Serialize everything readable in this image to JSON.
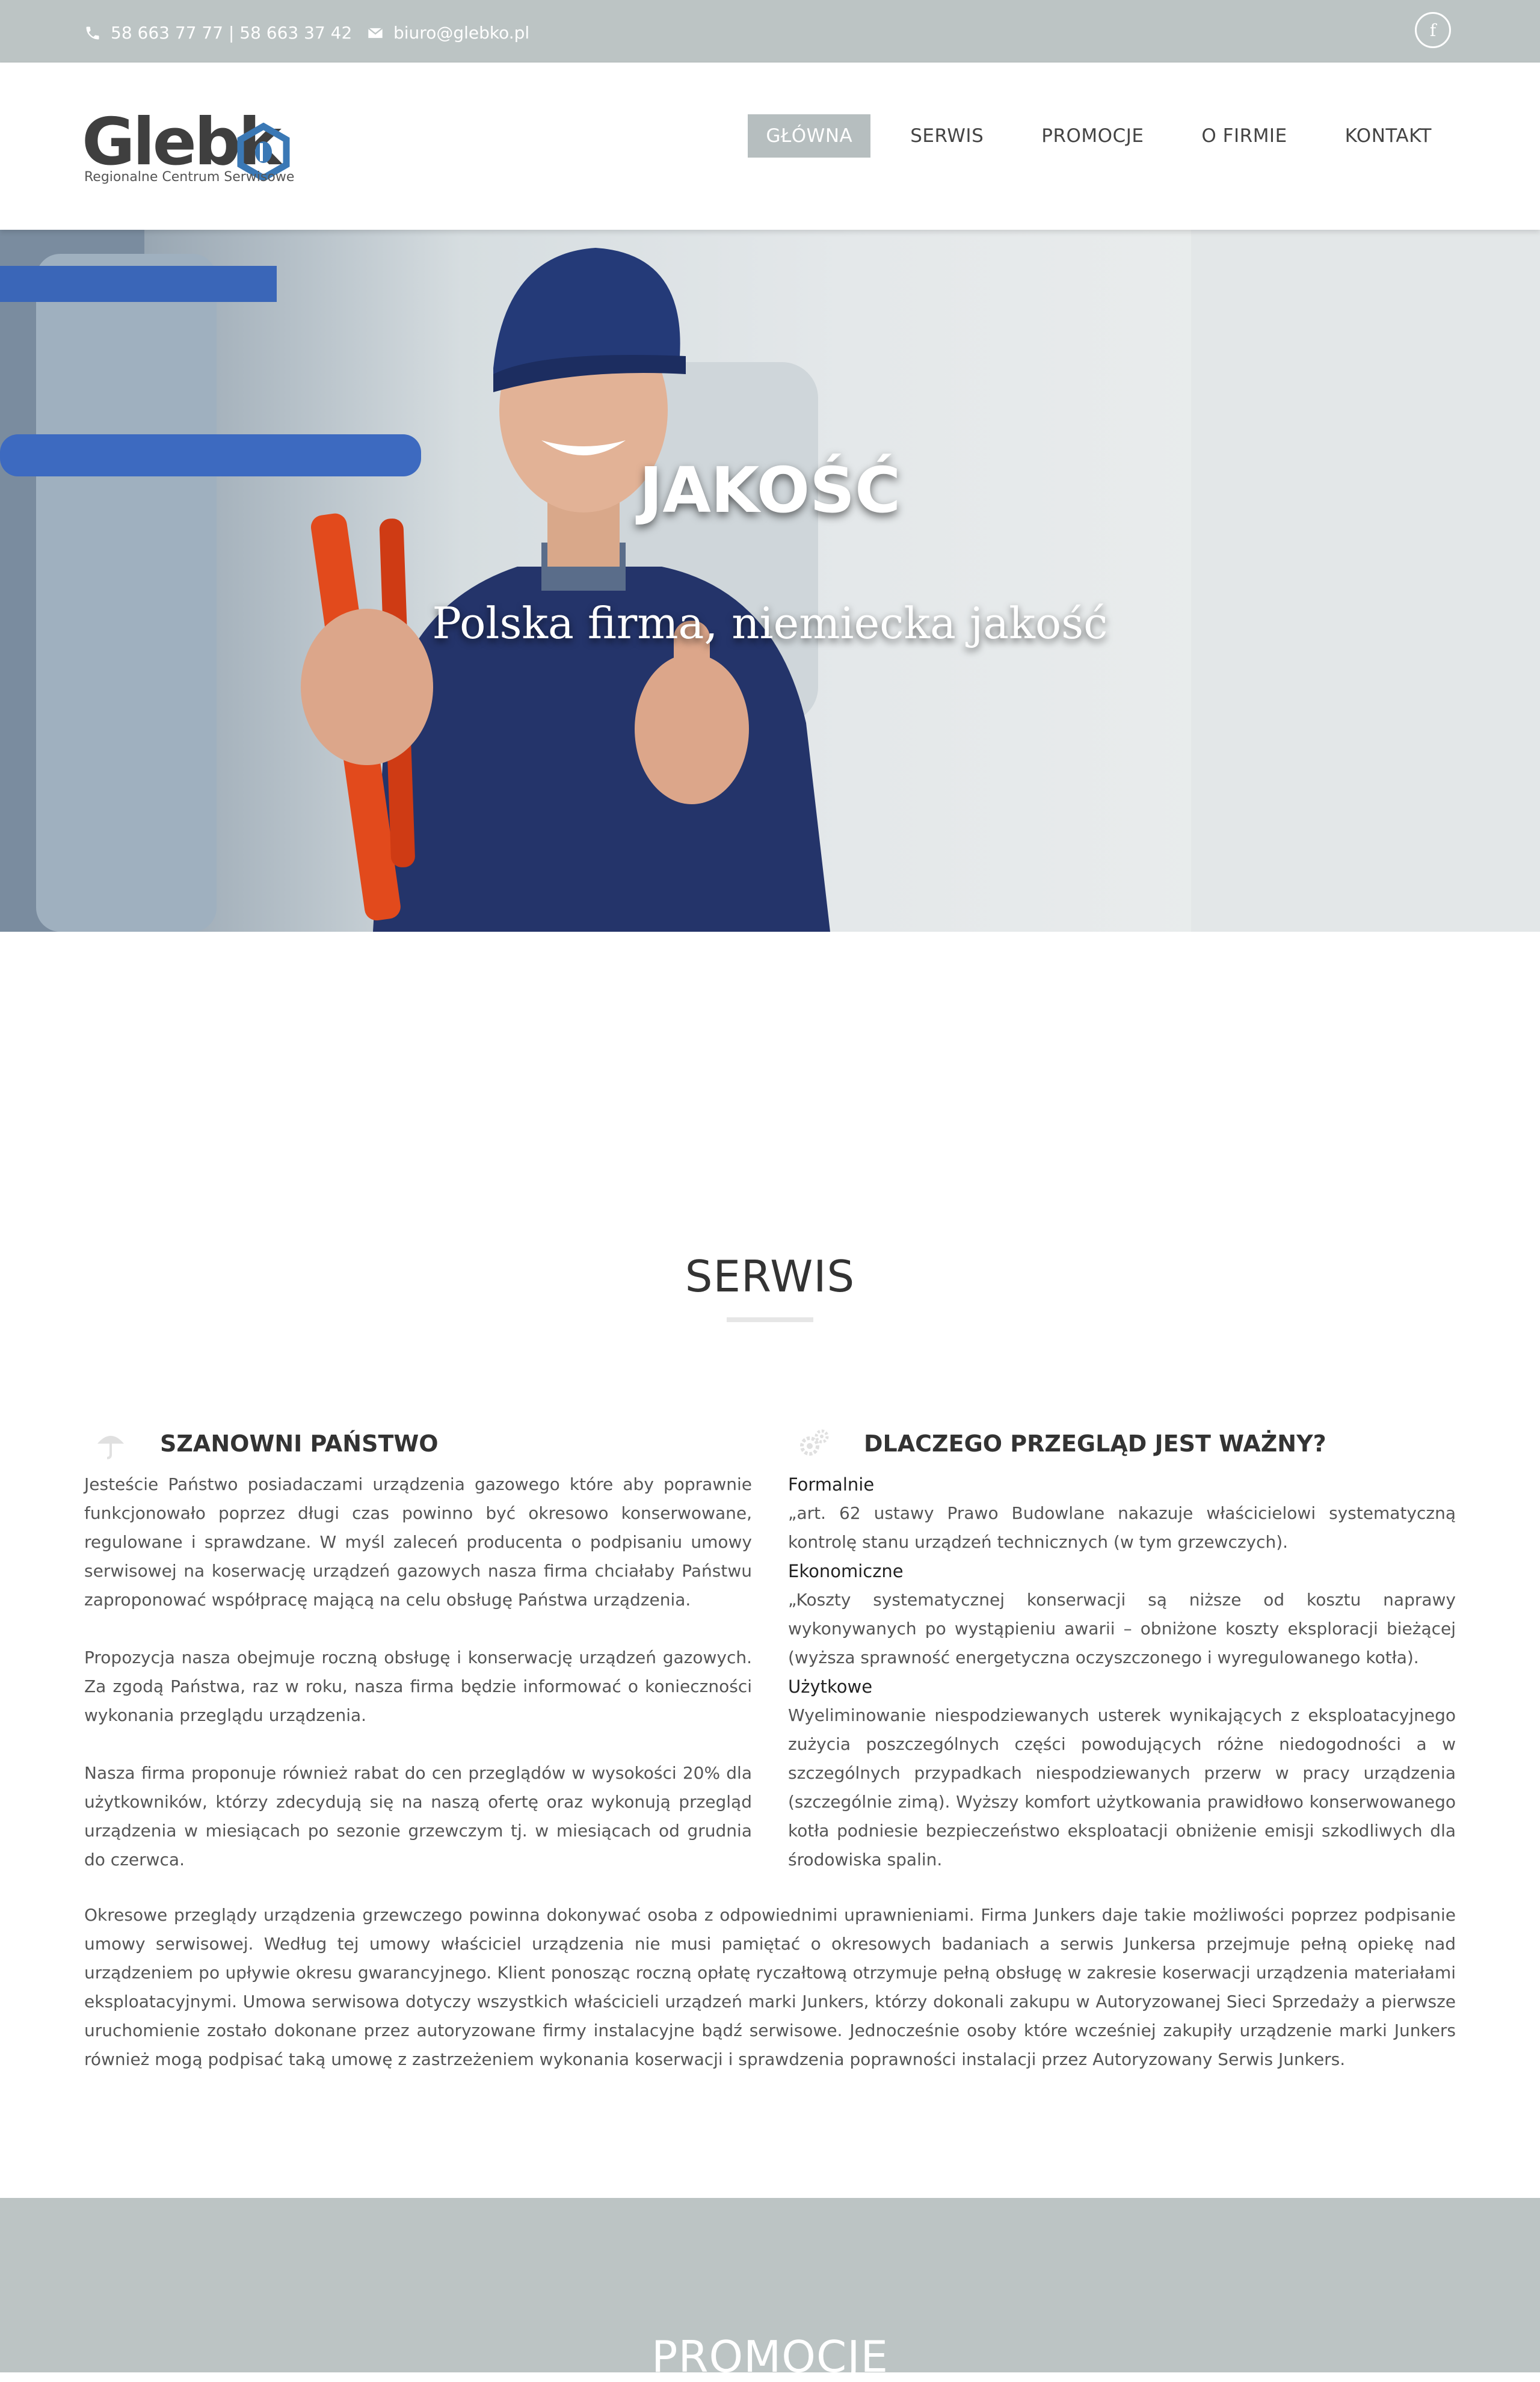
{
  "topbar": {
    "phone": "58 663 77 77 | 58 663 37 42",
    "email": "biuro@glebko.pl",
    "phone_icon": "phone-icon",
    "email_icon": "envelope-icon",
    "social_icon": "facebook-icon",
    "social_label": "f"
  },
  "logo": {
    "name": "Glebk",
    "tagline": "Regionalne Centrum Serwisowe"
  },
  "nav": {
    "items": [
      "GŁÓWNA",
      "SERWIS",
      "PROMOCJE",
      "O FIRMIE",
      "KONTAKT"
    ],
    "active": "GŁÓWNA"
  },
  "hero": {
    "title": "JAKOŚĆ",
    "subtitle": "Polska firma, niemiecka jakość"
  },
  "serwis": {
    "title": "SERWIS",
    "left": {
      "heading": "SZANOWNI PAŃSTWO",
      "icon": "umbrella-icon",
      "paragraphs": [
        "Jesteście Państwo posiadaczami urządzenia gazowego które aby poprawnie funkcjonowało poprzez długi czas powinno być okresowo konserwowane, regulowane i sprawdzane. W myśl zaleceń producenta o podpisaniu umowy serwisowej na koserwację urządzeń gazowych nasza firma chciałaby Państwu zaproponować współpracę mającą na celu obsługę Państwa urządzenia.",
        "Propozycja nasza obejmuje roczną obsługę i konserwację urządzeń gazowych. Za zgodą Państwa, raz w roku, nasza firma będzie informować o konieczności wykonania przeglądu urządzenia.",
        "Nasza firma proponuje również rabat do cen przeglądów w wysokości 20% dla użytkowników, którzy zdecydują się na naszą ofertę oraz wykonują przegląd urządzenia w miesiącach po sezonie grzewczym tj. w miesiącach od grudnia do czerwca."
      ]
    },
    "right": {
      "heading": "DLACZEGO PRZEGLĄD JEST WAŻNY?",
      "icon": "gears-icon",
      "blocks": [
        {
          "label": "Formalnie",
          "text": "„art. 62 ustawy Prawo Budowlane nakazuje właścicielowi systematyczną kontrolę stanu urządzeń technicznych (w tym grzewczych)."
        },
        {
          "label": "Ekonomiczne",
          "text": "„Koszty systematycznej konserwacji są niższe od kosztu naprawy wykonywanych po wystąpieniu awarii – obniżone koszty eksploracji bieżącej (wyższa sprawność energetyczna oczyszczonego i wyregulowanego kotła)."
        },
        {
          "label": "Użytkowe",
          "text": "Wyeliminowanie niespodziewanych usterek wynikających z eksploatacyjnego zużycia poszczególnych części powodujących różne niedogodności a w szczególnych przypadkach niespodziewanych przerw w pracy urządzenia (szczególnie zimą). Wyższy komfort użytkowania prawidłowo konserwowanego kotła podniesie bezpieczeństwo eksploatacji obniżenie emisji szkodliwych dla środowiska spalin."
        }
      ]
    },
    "full_text": "Okresowe przeglądy urządzenia grzewczego powinna dokonywać osoba z odpowiednimi uprawnieniami. Firma Junkers daje takie możliwości poprzez podpisanie umowy serwisowej. Według tej umowy właściciel urządzenia nie musi pamiętać o okresowych badaniach a serwis Junkersa przejmuje pełną opiekę nad urządzeniem po upływie okresu gwarancyjnego. Klient ponosząc roczną opłatę ryczałtową otrzymuje pełną obsługę w zakresie koserwacji urządzenia materiałami eksploatacyjnymi. Umowa serwisowa dotyczy wszystkich właścicieli urządzeń marki Junkers, którzy dokonali zakupu w Autoryzowanej Sieci Sprzedaży a pierwsze uruchomienie zostało dokonane przez autoryzowane firmy instalacyjne bądź serwisowe. Jednocześnie osoby które wcześniej zakupiły urządzenie marki Junkers również mogą podpisać taką umowę z zastrzeżeniem wykonania koserwacji i sprawdzenia poprawności instalacji przez Autoryzowany Serwis Junkers."
  },
  "promocje": {
    "title": "PROMOCJE"
  },
  "colors": {
    "topbar_bg": "#bcc4c4",
    "nav_active_bg": "#b6bebf",
    "logo_blue": "#3a78b5",
    "text": "#555555",
    "heading": "#333333"
  }
}
